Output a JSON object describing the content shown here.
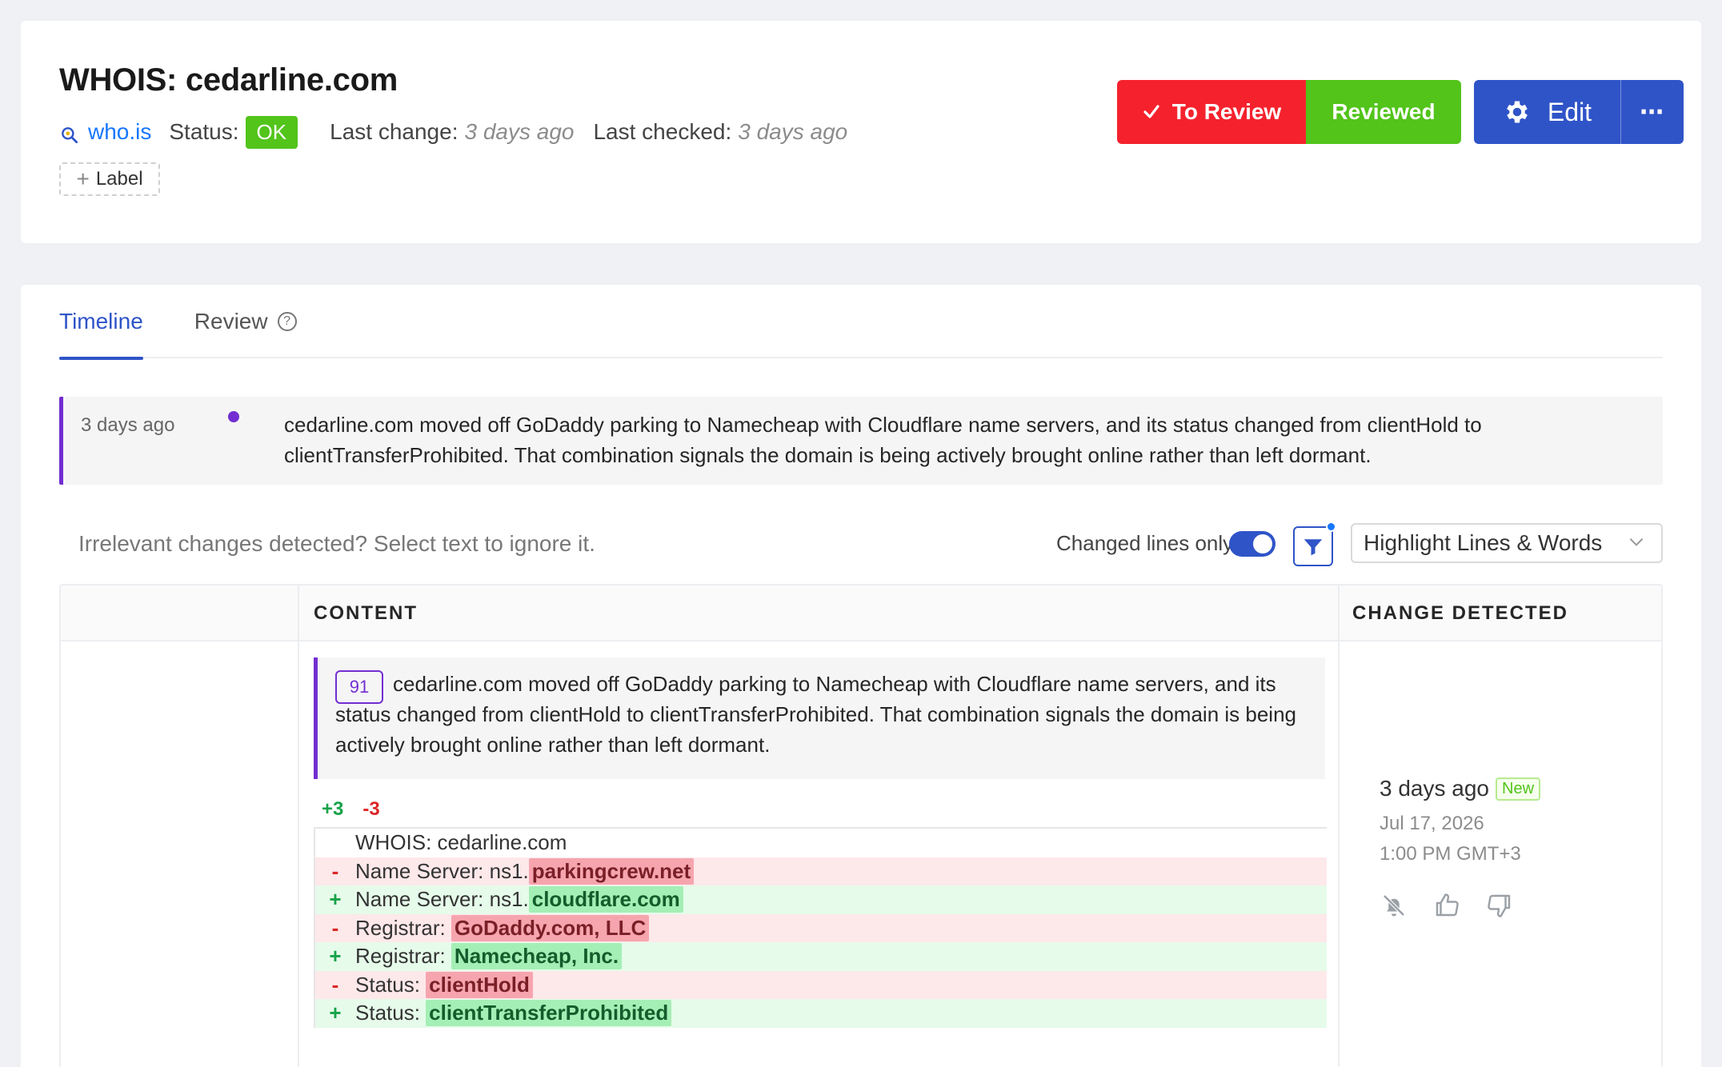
{
  "header": {
    "title": "WHOIS: cedarline.com",
    "source_link": "who.is",
    "status_label": "Status:",
    "status_value": "OK",
    "last_change_label": "Last change:",
    "last_change_value": "3 days ago",
    "last_checked_label": "Last checked:",
    "last_checked_value": "3 days ago",
    "add_label_text": "Label",
    "to_review_label": "To Review",
    "reviewed_label": "Reviewed",
    "edit_label": "Edit",
    "more_label": "⋯"
  },
  "tabs": [
    {
      "label": "Timeline"
    },
    {
      "label": "Review"
    }
  ],
  "timeline": {
    "time": "3 days ago",
    "text": "cedarline.com moved off GoDaddy parking to Namecheap with Cloudflare name servers, and its status changed from clientHold to clientTransferProhibited. That combination signals the domain is being actively brought online rather than left dormant."
  },
  "toolbar": {
    "ignore_hint": "Irrelevant changes detected? Select text to ignore it.",
    "changed_lines_only": "Changed lines only",
    "highlight_mode": "Highlight Lines & Words"
  },
  "table": {
    "headers": {
      "content": "CONTENT",
      "change_detected": "CHANGE DETECTED"
    },
    "summary": {
      "score": "91",
      "text": "cedarline.com moved off GoDaddy parking to Namecheap with Cloudflare name servers, and its status changed from clientHold to clientTransferProhibited. That combination signals the domain is being actively brought online rather than left dormant."
    },
    "added_count": "+3",
    "removed_count": "-3",
    "diff_lines": [
      {
        "type": "ctx",
        "sign": "",
        "text": "WHOIS: cedarline.com",
        "highlight": ""
      },
      {
        "type": "del",
        "sign": "-",
        "text": "Name Server: ns1.",
        "highlight": "parkingcrew.net"
      },
      {
        "type": "add",
        "sign": "+",
        "text": "Name Server: ns1.",
        "highlight": "cloudflare.com"
      },
      {
        "type": "del",
        "sign": "-",
        "text": "Registrar: ",
        "highlight": "GoDaddy.com, LLC"
      },
      {
        "type": "add",
        "sign": "+",
        "text": "Registrar: ",
        "highlight": "Namecheap, Inc."
      },
      {
        "type": "del",
        "sign": "-",
        "text": "Status: ",
        "highlight": "clientHold"
      },
      {
        "type": "add",
        "sign": "+",
        "text": "Status: ",
        "highlight": "clientTransferProhibited"
      }
    ],
    "change": {
      "relative": "3 days ago",
      "badge": "New",
      "date": "Jul 17, 2026",
      "time": "1:00 PM GMT+3"
    }
  },
  "colors": {
    "accent": "#2f54c8",
    "danger": "#f5222d",
    "success": "#52c41a",
    "purple": "#722ed1"
  }
}
